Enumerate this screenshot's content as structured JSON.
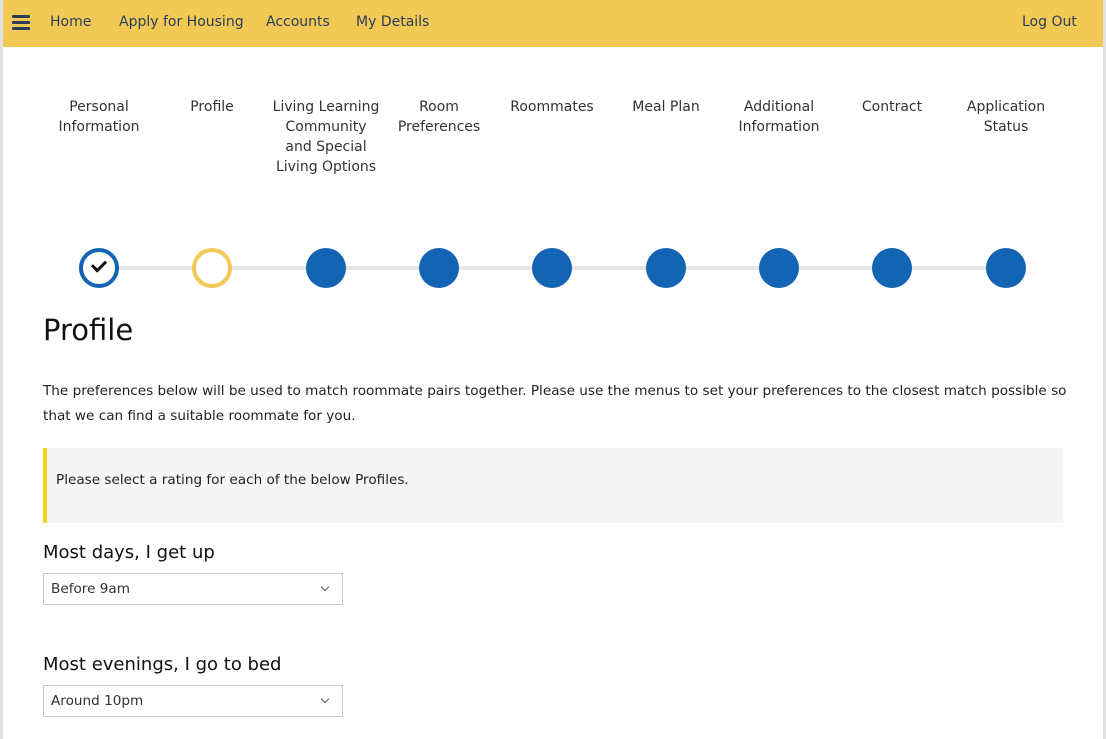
{
  "nav": {
    "menu_icon": "hamburger-menu-icon",
    "links": [
      "Home",
      "Apply for Housing",
      "Accounts",
      "My Details"
    ],
    "logout": "Log Out",
    "bar_color": "#f3c955"
  },
  "stepper": {
    "steps": [
      {
        "label": "Personal Information",
        "state": "completed"
      },
      {
        "label": "Profile",
        "state": "current"
      },
      {
        "label": "Living Learning Community and Special Living Options",
        "state": "upcoming"
      },
      {
        "label": "Room Preferences",
        "state": "upcoming"
      },
      {
        "label": "Roommates",
        "state": "upcoming"
      },
      {
        "label": "Meal Plan",
        "state": "upcoming"
      },
      {
        "label": "Additional Information",
        "state": "upcoming"
      },
      {
        "label": "Contract",
        "state": "upcoming"
      },
      {
        "label": "Application Status",
        "state": "upcoming"
      }
    ],
    "completed_icon": "checkmark-icon",
    "colors": {
      "step": "#1464b4",
      "current": "#f3c955",
      "track": "#e6e6e6"
    }
  },
  "page": {
    "title": "Profile",
    "intro": "The preferences below will be used to match roommate pairs together. Please use the menus to set your preferences to the closest match possible so that we can find a suitable roommate for you.",
    "notice": "Please select a rating for each of the below Profiles."
  },
  "questions": [
    {
      "label": "Most days, I get up",
      "selected": "Before 9am"
    },
    {
      "label": "Most evenings, I go to bed",
      "selected": "Around 10pm"
    }
  ]
}
